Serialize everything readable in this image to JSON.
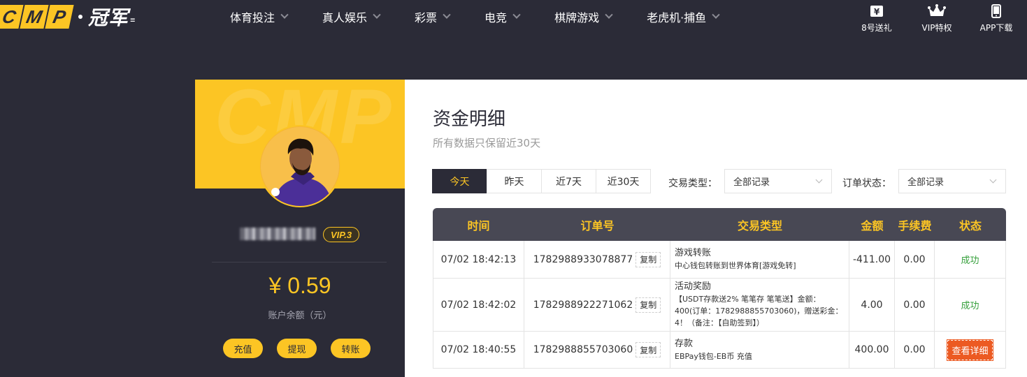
{
  "brand": {
    "letters": [
      "C",
      "M",
      "P"
    ],
    "name_cn": "冠军",
    "tail": "="
  },
  "nav": {
    "items": [
      {
        "label": "体育投注"
      },
      {
        "label": "真人娱乐"
      },
      {
        "label": "彩票"
      },
      {
        "label": "电竞"
      },
      {
        "label": "棋牌游戏"
      },
      {
        "label": "老虎机·捕鱼"
      }
    ]
  },
  "tools": [
    {
      "label": "8号送礼",
      "icon": "gift-ticket-icon"
    },
    {
      "label": "VIP特权",
      "icon": "crown-icon"
    },
    {
      "label": "APP下载",
      "icon": "phone-icon"
    }
  ],
  "card": {
    "watermark": "CMP",
    "vip_label": "VIP.3",
    "balance": "¥ 0.59",
    "balance_label": "账户余额（元）",
    "actions": [
      {
        "label": "充值"
      },
      {
        "label": "提现"
      },
      {
        "label": "转账"
      }
    ]
  },
  "panel": {
    "title": "资金明细",
    "subtitle": "所有数据只保留近30天",
    "ranges": [
      {
        "label": "今天",
        "active": true
      },
      {
        "label": "昨天",
        "active": false
      },
      {
        "label": "近7天",
        "active": false
      },
      {
        "label": "近30天",
        "active": false
      }
    ],
    "filters": {
      "type_label": "交易类型：",
      "type_value": "全部记录",
      "status_label": "订单状态：",
      "status_value": "全部记录"
    }
  },
  "table": {
    "headers": [
      "时间",
      "订单号",
      "交易类型",
      "金额",
      "手续费",
      "状态"
    ],
    "copy_label": "复制",
    "rows": [
      {
        "time": "07/02 18:42:13",
        "order_no": "1782988933078877",
        "type_title": "游戏转账",
        "type_desc": "中心钱包转账到世界体育[游戏免转]",
        "amount": "-411.00",
        "fee": "0.00",
        "status": "成功",
        "status_kind": "success"
      },
      {
        "time": "07/02 18:42:02",
        "order_no": "1782988922271062",
        "type_title": "活动奖励",
        "type_desc": "【USDT存款送2% 笔笔存 笔笔送】金额：400(订单：1782988855703060)，赠送彩金：4！（备注：【自助签到】）",
        "amount": "4.00",
        "fee": "0.00",
        "status": "成功",
        "status_kind": "success"
      },
      {
        "time": "07/02 18:40:55",
        "order_no": "1782988855703060",
        "type_title": "存款",
        "type_desc": "EBPay钱包-EB币 充值",
        "amount": "400.00",
        "fee": "0.00",
        "status": "查看详细",
        "status_kind": "detail"
      }
    ]
  },
  "colors": {
    "accent": "#fcc524",
    "dark": "#2b2b37",
    "success": "#36a03c",
    "detail": "#ec5a22"
  }
}
